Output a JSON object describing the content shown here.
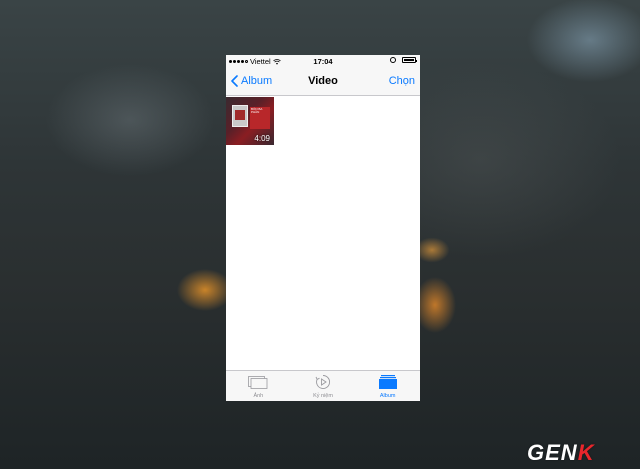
{
  "status_bar": {
    "carrier": "Viettel",
    "time": "17:04"
  },
  "nav": {
    "back_label": "Album",
    "title": "Video",
    "select_label": "Chọn"
  },
  "videos": [
    {
      "duration": "4:09",
      "thumb_text": "BÒN BA PHẦN"
    }
  ],
  "tabs": [
    {
      "label": "Ảnh",
      "icon": "photos-icon",
      "active": false
    },
    {
      "label": "Kỷ niệm",
      "icon": "memories-icon",
      "active": false
    },
    {
      "label": "Album",
      "icon": "albums-icon",
      "active": true
    }
  ],
  "watermark": {
    "text_a": "GEN",
    "text_b": "K"
  },
  "colors": {
    "accent": "#0a7aff",
    "watermark_red": "#e8262c"
  }
}
